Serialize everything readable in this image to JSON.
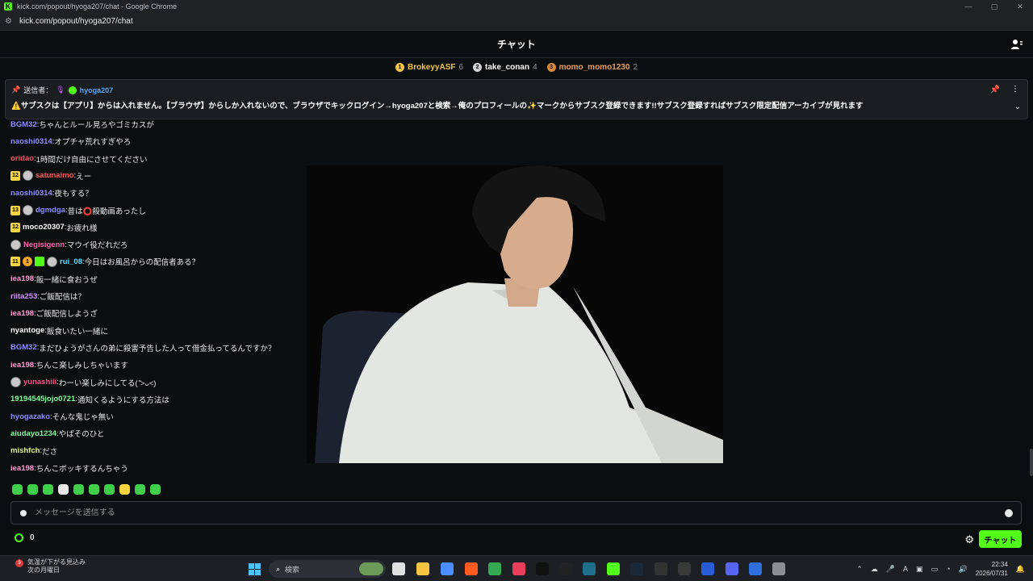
{
  "window": {
    "title": "kick.com/popout/hyoga207/chat - Google Chrome",
    "url": "kick.com/popout/hyoga207/chat",
    "controls": [
      "—",
      "▢",
      "✕"
    ]
  },
  "header": {
    "title": "チャット"
  },
  "top_gifters": [
    {
      "rank": "1",
      "name": "BrokeyyASF",
      "count": "6",
      "color": "#f5c542",
      "rank_color": "#f5c542"
    },
    {
      "rank": "2",
      "name": "take_conan",
      "count": "4",
      "color": "#ffffff",
      "rank_color": "#cfd3d6"
    },
    {
      "rank": "3",
      "name": "momo_momo1230",
      "count": "2",
      "color": "#e8a15a",
      "rank_color": "#d98a3b"
    }
  ],
  "pinned": {
    "label": "送信者：",
    "sender": "hyoga207",
    "message": "⚠️サブスクは【アプリ】からは入れません。【ブラウザ】からしか入れないので、ブラウザでキックログイン→hyoga207と検索→俺のプロフィールの✨マークからサブスク登録できます!!サブスク登録すればサブスク限定配信アーカイブが見れます"
  },
  "messages": [
    {
      "badges": [],
      "user": "BGM32",
      "color": "#8f8cff",
      "text": "ちゃんとルール見ろやゴミカスが"
    },
    {
      "badges": [],
      "user": "naoshi0314",
      "color": "#8f8cff",
      "text": "オプチャ荒れすぎやろ"
    },
    {
      "badges": [],
      "user": "oridao",
      "color": "#ff4d6a",
      "text": "1時間だけ自由にさせてください"
    },
    {
      "badges": [
        "12",
        "avatar"
      ],
      "user": "satunaimo",
      "color": "#ff5c5c",
      "text": "えー"
    },
    {
      "badges": [],
      "user": "naoshi0314",
      "color": "#8f8cff",
      "text": "夜もする？"
    },
    {
      "badges": [
        "13",
        "avatar"
      ],
      "user": "dgmdga",
      "color": "#8f8cff",
      "text": "昔は⭕殺動画あったし"
    },
    {
      "badges": [
        "12"
      ],
      "user": "moco20307",
      "color": "#ffffff",
      "text": "お疲れ様"
    },
    {
      "badges": [
        "avatar"
      ],
      "user": "Negisigenn",
      "color": "#ff5fae",
      "text": "マウイ役だれだろ"
    },
    {
      "badges": [
        "11",
        "coin",
        "green",
        "avatar"
      ],
      "user": "rui_08",
      "color": "#53e0ff",
      "text": "今日はお風呂からの配信者ある？"
    },
    {
      "badges": [],
      "user": "iea198",
      "color": "#ff9ad5",
      "text": "飯一緒に食おうぜ"
    },
    {
      "badges": [],
      "user": "riita253",
      "color": "#d58cff",
      "text": "ご飯配信は？"
    },
    {
      "badges": [],
      "user": "iea198",
      "color": "#ff9ad5",
      "text": "ご飯配信しようざ"
    },
    {
      "badges": [],
      "user": "nyantoge",
      "color": "#ffffff",
      "text": "飯食いたい一緒に"
    },
    {
      "badges": [],
      "user": "BGM32",
      "color": "#8f8cff",
      "text": "まだひょうがさんの弟に殺害予告した人って借金払ってるんですか？"
    },
    {
      "badges": [],
      "user": "iea198",
      "color": "#ff9ad5",
      "text": "ちんこ楽しみしちゃいます"
    },
    {
      "badges": [
        "avatar"
      ],
      "user": "yunashiii",
      "color": "#ff4d8a",
      "text": "わーい楽しみにしてる(ˊ᷄>ᴗ<)"
    },
    {
      "badges": [],
      "user": "19194545jojo0721",
      "color": "#7cff9a",
      "text": "通知くるようにする方法は"
    },
    {
      "badges": [],
      "user": "hyogazako",
      "color": "#8f8cff",
      "text": "そんな鬼じゃ無い"
    },
    {
      "badges": [],
      "user": "aiudayo1234",
      "color": "#7cff9a",
      "text": "やばそのひと"
    },
    {
      "badges": [],
      "user": "mishfch",
      "color": "#e8f58c",
      "text": "ださ"
    },
    {
      "badges": [],
      "user": "iea198",
      "color": "#ff9ad5",
      "text": "ちんこボッキするんちゃう"
    }
  ],
  "composer": {
    "placeholder": "メッセージを送信する"
  },
  "footer": {
    "points": "0",
    "send_label": "チャット"
  },
  "taskbar": {
    "weather_count": "9",
    "weather_line1": "気温が下がる見込み",
    "weather_line2": "次の月曜日",
    "search_placeholder": "検索",
    "time": "22:34",
    "date": "2026/07/31"
  },
  "colors": {
    "accent": "#53fc18",
    "background": "#0b0e0f"
  }
}
